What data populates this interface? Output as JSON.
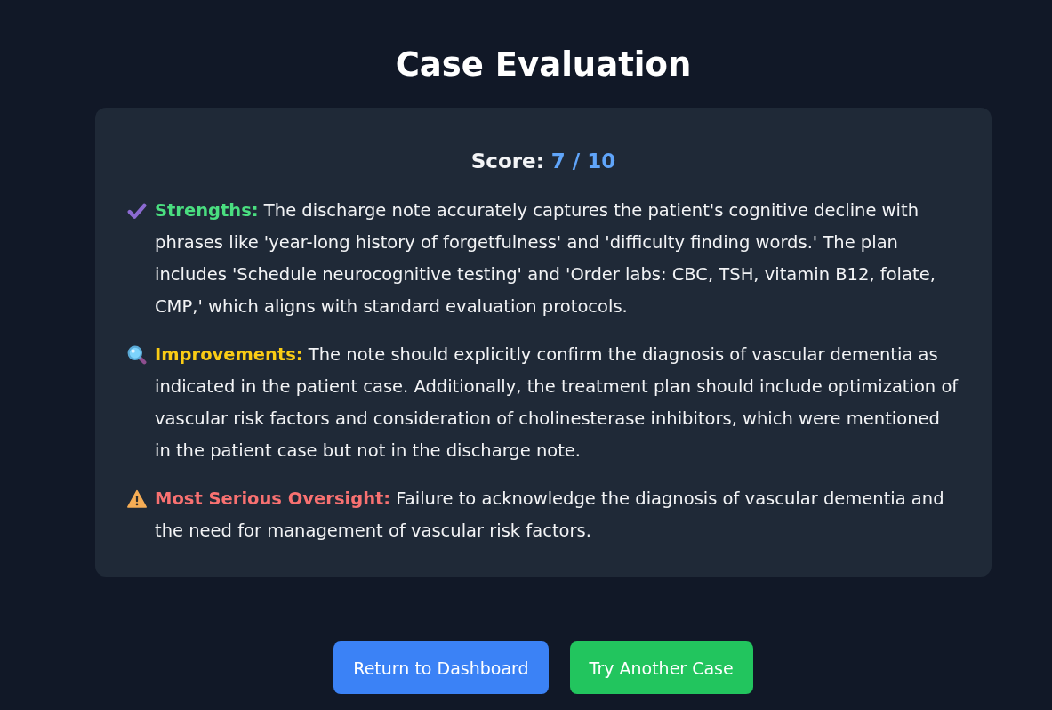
{
  "title": "Case Evaluation",
  "score": {
    "label": "Score:",
    "value": "7 / 10"
  },
  "sections": [
    {
      "kind": "strengths",
      "label": "Strengths:",
      "text": "The discharge note accurately captures the patient's cognitive decline with phrases like 'year-long history of forgetfulness' and 'difficulty finding words.' The plan includes 'Schedule neurocognitive testing' and 'Order labs: CBC, TSH, vitamin B12, folate, CMP,' which aligns with standard evaluation protocols."
    },
    {
      "kind": "improvements",
      "label": "Improvements:",
      "text": "The note should explicitly confirm the diagnosis of vascular dementia as indicated in the patient case. Additionally, the treatment plan should include optimization of vascular risk factors and consideration of cholinesterase inhibitors, which were mentioned in the patient case but not in the discharge note."
    },
    {
      "kind": "oversight",
      "label": "Most Serious Oversight:",
      "text": "Failure to acknowledge the diagnosis of vascular dementia and the need for management of vascular risk factors."
    }
  ],
  "buttons": [
    {
      "kind": "primary",
      "label": "Return to Dashboard"
    },
    {
      "kind": "success",
      "label": "Try Another Case"
    }
  ]
}
